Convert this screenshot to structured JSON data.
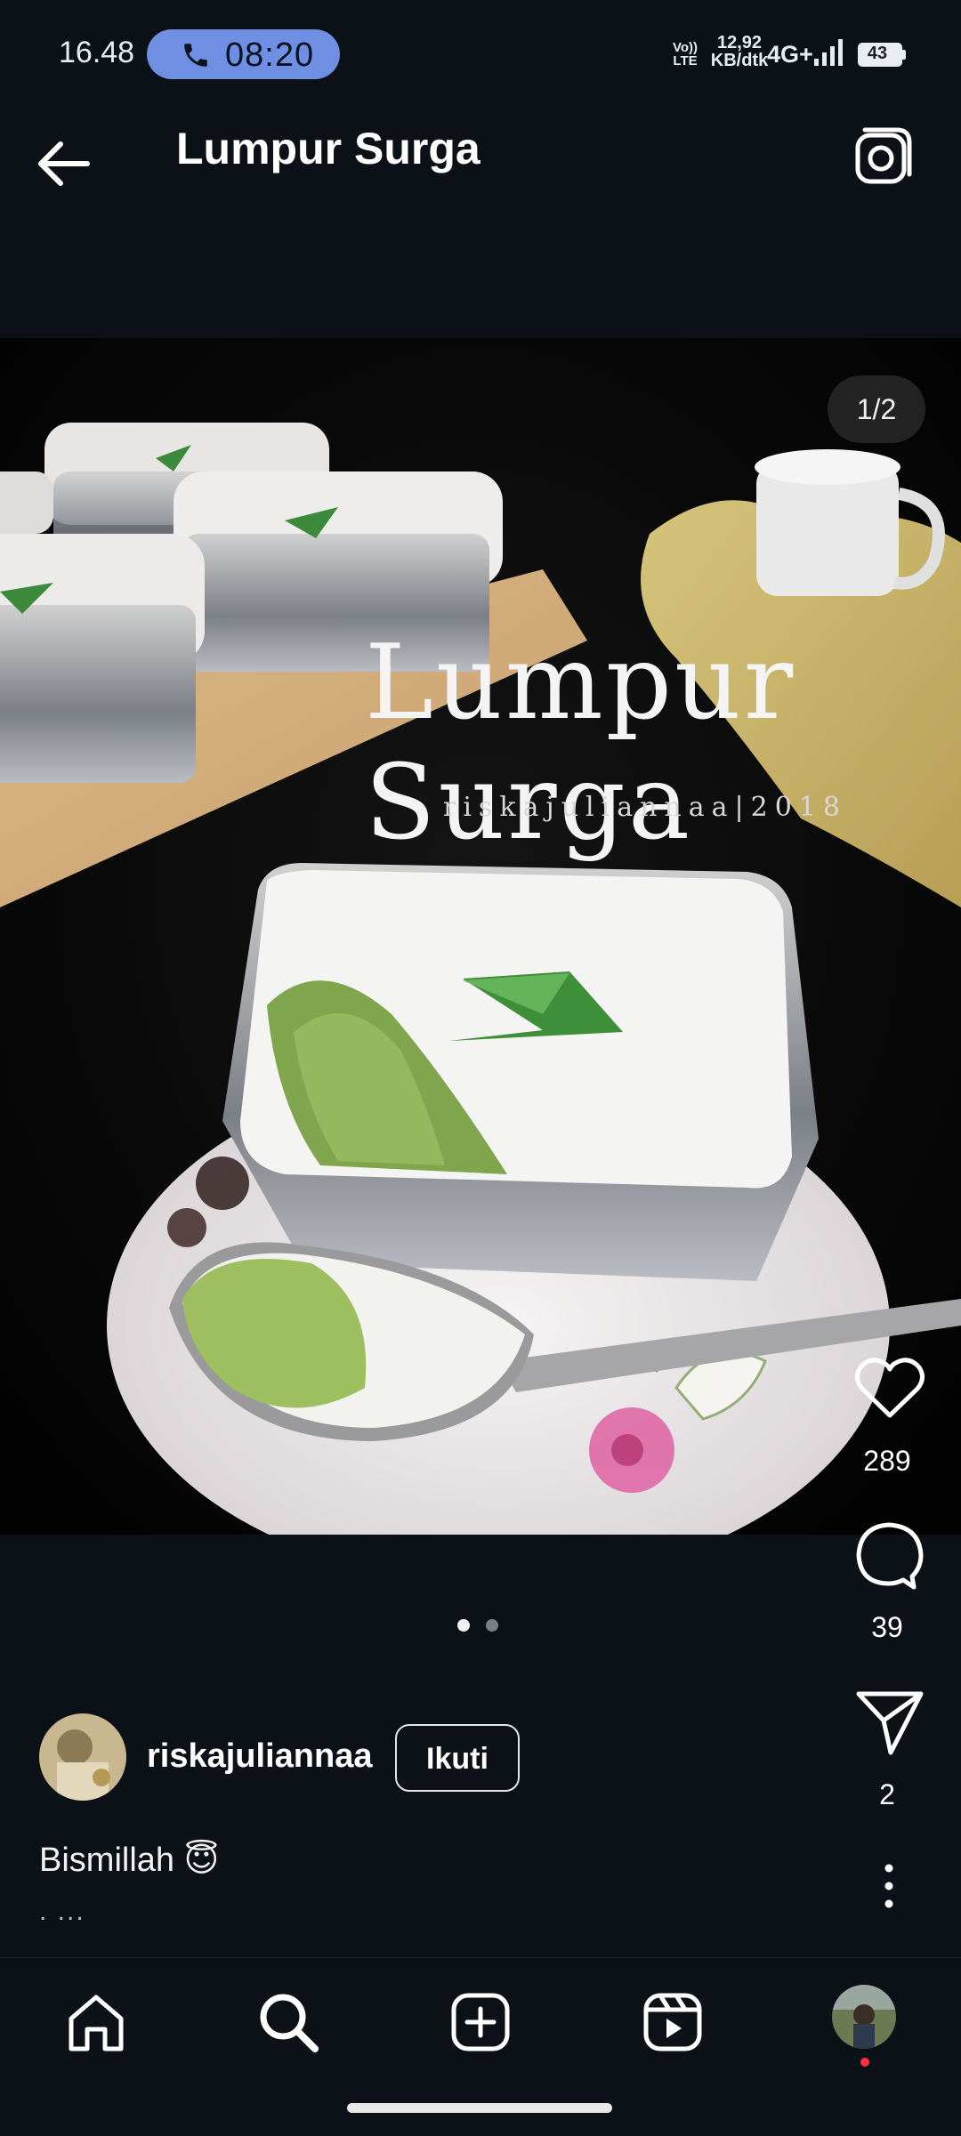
{
  "status_bar": {
    "time": "16.48",
    "call_time": "08:20",
    "volte": "Vo)) LTE",
    "speed_value": "12,92",
    "speed_unit": "KB/dtk",
    "network": "4G+",
    "battery": "43"
  },
  "header": {
    "title": "Lumpur Surga",
    "back_icon": "arrow-left-icon",
    "camera_icon": "camera-icon"
  },
  "post": {
    "image_counter": "1/2",
    "watermark_title": "Lumpur Surga",
    "watermark_sub": "riskajuliannaa|2018",
    "page_dots": {
      "total": 2,
      "active": 1
    },
    "likes": "289",
    "comments": "39",
    "shares": "2",
    "username": "riskajuliannaa",
    "follow_label": "Ikuti",
    "caption": "Bismillah 😇",
    "caption_more": ". ..."
  },
  "bottom_nav": {
    "items": [
      "home-icon",
      "search-icon",
      "add-post-icon",
      "reels-icon",
      "profile-avatar"
    ]
  },
  "colors": {
    "background": "#0c1017",
    "call_pill": "#6f8fe2",
    "notification_dot": "#ff3040"
  }
}
